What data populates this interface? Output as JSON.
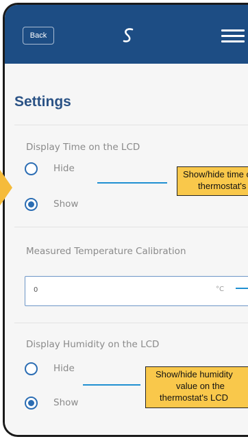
{
  "header": {
    "back_label": "Back",
    "logo_icon": "salus-logo-icon",
    "menu_icon": "hamburger-menu-icon",
    "bar_color": "#1d4d84"
  },
  "page": {
    "title": "Settings"
  },
  "display_time": {
    "label": "Display Time on the LCD",
    "options": [
      {
        "label": "Hide",
        "selected": false
      },
      {
        "label": "Show",
        "selected": true
      }
    ]
  },
  "calibration": {
    "label": "Measured Temperature Calibration",
    "value": "0",
    "unit": "°C"
  },
  "display_humidity": {
    "label": "Display Humidity on the LCD",
    "options": [
      {
        "label": "Hide",
        "selected": false
      },
      {
        "label": "Show",
        "selected": true
      }
    ]
  },
  "callouts": {
    "time_line1": "Show/hide time on the",
    "time_line2": "thermostat's LCD",
    "humidity_line1": "Show/hide humidity",
    "humidity_line2": "value on the",
    "humidity_line3": "thermostat's LCD",
    "color": "#f9c84b"
  },
  "accent_color": "#2b6db3"
}
